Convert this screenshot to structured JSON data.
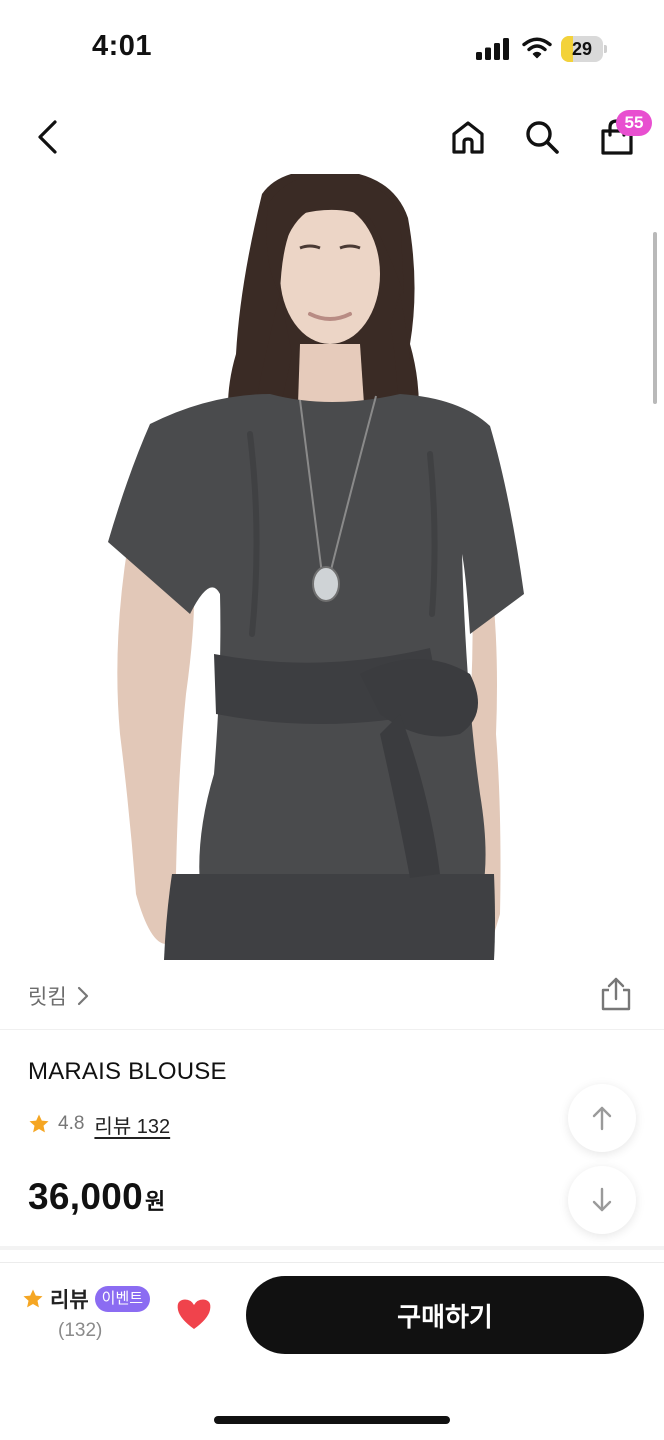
{
  "status_bar": {
    "time": "4:01",
    "battery": "29",
    "battery_level": 0.29
  },
  "nav": {
    "back_icon": "chevron-left-icon",
    "home_icon": "home-icon",
    "search_icon": "search-icon",
    "cart_icon": "shopping-bag-icon",
    "cart_count": "55"
  },
  "product": {
    "brand": "릿킴",
    "name": "MARAIS BLOUSE",
    "rating": "4.8",
    "review_link": "리뷰 132",
    "price": "36,000",
    "price_unit": "원"
  },
  "bottom_bar": {
    "review_label": "리뷰",
    "event_badge": "이벤트",
    "review_count": "(132)",
    "buy_label": "구매하기"
  },
  "colors": {
    "badge": "#e84fd0",
    "event": "#8b6cf2",
    "star": "#f5a623",
    "heart": "#f0434c",
    "buy_button": "#111111"
  }
}
